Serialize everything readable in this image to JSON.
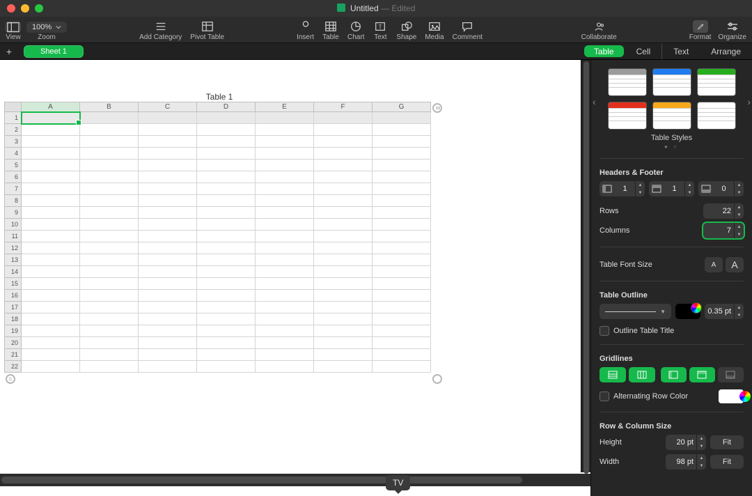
{
  "window": {
    "title": "Untitled",
    "status": "Edited"
  },
  "toolbar": {
    "view": "View",
    "zoom_label": "Zoom",
    "zoom_value": "100%",
    "add_category": "Add Category",
    "pivot": "Pivot Table",
    "insert": "Insert",
    "table": "Table",
    "chart": "Chart",
    "text": "Text",
    "shape": "Shape",
    "media": "Media",
    "comment": "Comment",
    "collaborate": "Collaborate",
    "format": "Format",
    "organize": "Organize"
  },
  "sheets": {
    "tab1": "Sheet 1"
  },
  "inspector_tabs": {
    "table": "Table",
    "cell": "Cell",
    "text": "Text",
    "arrange": "Arrange"
  },
  "table": {
    "title": "Table 1",
    "columns": [
      "A",
      "B",
      "C",
      "D",
      "E",
      "F",
      "G"
    ],
    "row_count": 22
  },
  "inspector": {
    "styles_label": "Table Styles",
    "style_colors": [
      "#9b9b9b",
      "#1f7def",
      "#27ae1f",
      "#e22f1d",
      "#f7a81b",
      "#ffffff"
    ],
    "headers_footer": "Headers & Footer",
    "hf_cols": "1",
    "hf_rows": "1",
    "hf_foot": "0",
    "rows_label": "Rows",
    "rows_value": "22",
    "cols_label": "Columns",
    "cols_value": "7",
    "font_size_label": "Table Font Size",
    "outline_label": "Table Outline",
    "outline_pt": "0.35 pt",
    "outline_title": "Outline Table Title",
    "gridlines_label": "Gridlines",
    "alt_row": "Alternating Row Color",
    "rowcol_size": "Row & Column Size",
    "height_label": "Height",
    "height_val": "20 pt",
    "width_label": "Width",
    "width_val": "98 pt",
    "fit": "Fit"
  },
  "tooltip": "TV"
}
